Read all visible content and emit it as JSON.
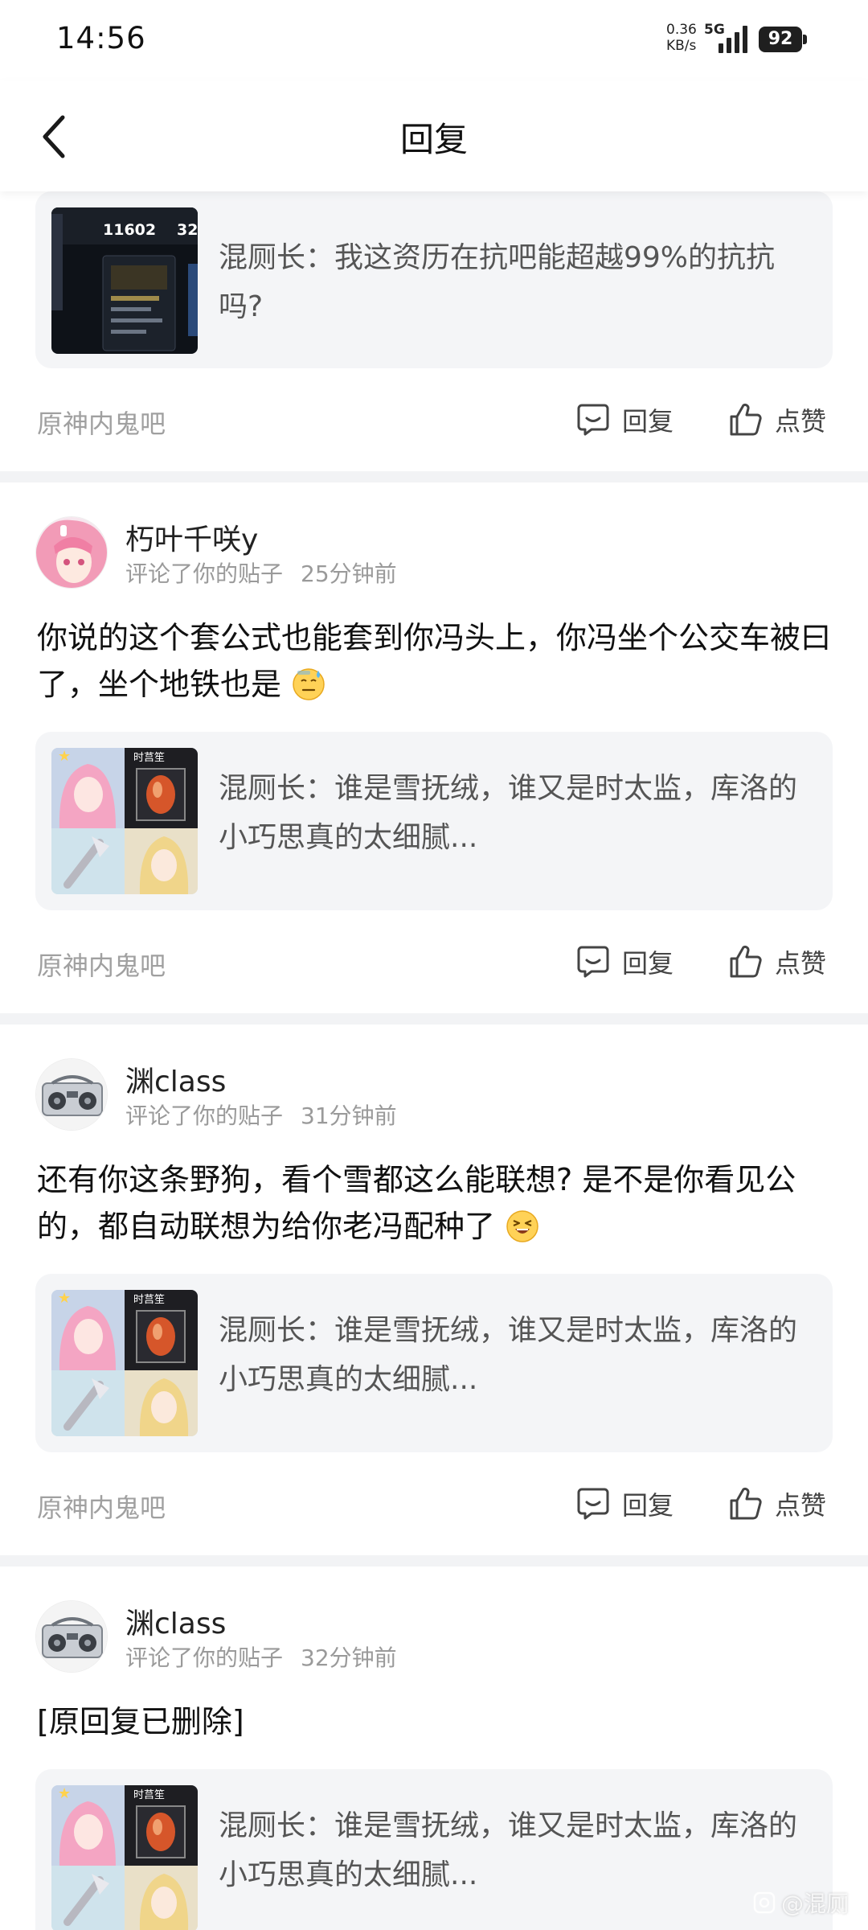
{
  "status_bar": {
    "time": "14:56",
    "net_speed_value": "0.36",
    "net_speed_unit": "KB/s",
    "network_type": "5G",
    "battery": "92"
  },
  "header": {
    "title": "回复"
  },
  "first_card": {
    "quote_text": "混厕长：我这资历在抗吧能超越99%的抗抗吗?",
    "thumb_stat_left": "11602",
    "thumb_stat_right": "32",
    "forum": "原神内鬼吧",
    "reply_label": "回复",
    "like_label": "点赞"
  },
  "cards": [
    {
      "username": "朽叶千咲y",
      "action": "评论了你的贴子",
      "time": "25分钟前",
      "comment": "你说的这个套公式也能套到你冯头上，你冯坐个公交车被曰了，坐个地铁也是",
      "emoji": "sweat-face-emoji",
      "quote_text": "混厕长：谁是雪抚绒，谁又是时太监，库洛的小巧思真的太细腻...",
      "forum": "原神内鬼吧",
      "reply_label": "回复",
      "like_label": "点赞"
    },
    {
      "username": "渊class",
      "action": "评论了你的贴子",
      "time": "31分钟前",
      "comment": "还有你这条野狗，看个雪都这么能联想? 是不是你看见公的，都自动联想为给你老冯配种了",
      "emoji": "squint-grin-emoji",
      "quote_text": "混厕长：谁是雪抚绒，谁又是时太监，库洛的小巧思真的太细腻...",
      "forum": "原神内鬼吧",
      "reply_label": "回复",
      "like_label": "点赞"
    },
    {
      "username": "渊class",
      "action": "评论了你的贴子",
      "time": "32分钟前",
      "comment": "[原回复已删除]",
      "quote_text": "混厕长：谁是雪抚绒，谁又是时太监，库洛的小巧思真的太细腻..."
    }
  ],
  "thumb_tag": "时莒笙",
  "watermark": "@混厕"
}
